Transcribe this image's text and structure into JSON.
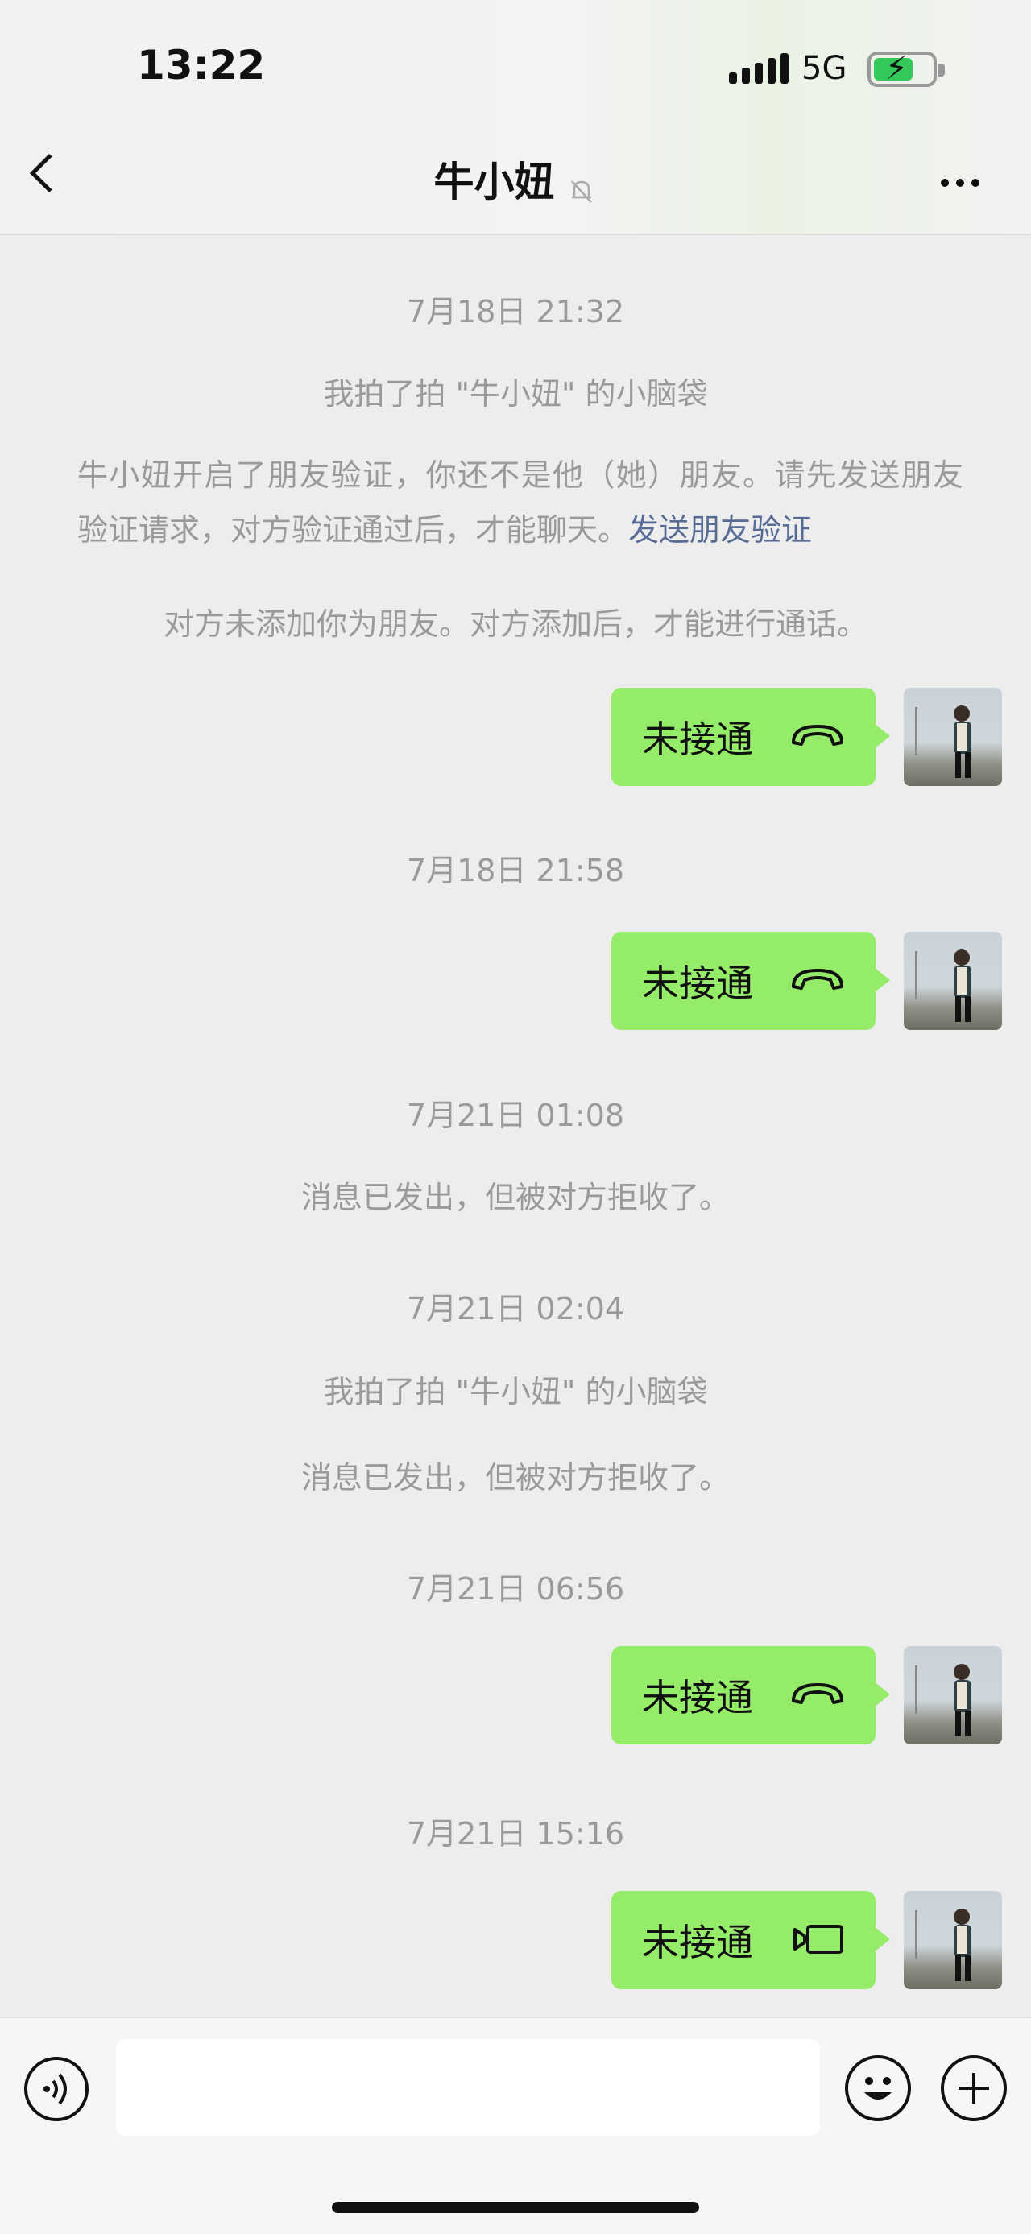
{
  "status_bar": {
    "time": "13:22",
    "network": "5G",
    "battery_level": 0.6,
    "charging": true
  },
  "nav": {
    "title": "牛小妞",
    "muted": true
  },
  "messages": [
    {
      "type": "timestamp",
      "text": "7月18日 21:32"
    },
    {
      "type": "system",
      "text": "我拍了拍 \"牛小妞\" 的小脑袋"
    },
    {
      "type": "system_link",
      "text": "牛小妞开启了朋友验证，你还不是他（她）朋友。请先发送朋友验证请求，对方验证通过后，才能聊天。",
      "link": "发送朋友验证"
    },
    {
      "type": "system",
      "text": "对方未添加你为朋友。对方添加后，才能进行通话。"
    },
    {
      "type": "call",
      "text": "未接通",
      "call_kind": "voice"
    },
    {
      "type": "timestamp",
      "text": "7月18日 21:58"
    },
    {
      "type": "call",
      "text": "未接通",
      "call_kind": "voice"
    },
    {
      "type": "timestamp",
      "text": "7月21日 01:08"
    },
    {
      "type": "system",
      "text": "消息已发出，但被对方拒收了。"
    },
    {
      "type": "timestamp",
      "text": "7月21日 02:04"
    },
    {
      "type": "system",
      "text": "我拍了拍 \"牛小妞\" 的小脑袋"
    },
    {
      "type": "system",
      "text": "消息已发出，但被对方拒收了。"
    },
    {
      "type": "timestamp",
      "text": "7月21日 06:56"
    },
    {
      "type": "call",
      "text": "未接通",
      "call_kind": "voice"
    },
    {
      "type": "timestamp",
      "text": "7月21日 15:16"
    },
    {
      "type": "call",
      "text": "未接通",
      "call_kind": "video"
    }
  ],
  "colors": {
    "bubble": "#95ec69",
    "link": "#576b95",
    "system_text": "#9a9a9a",
    "background": "#ededed"
  },
  "bottom_bar": {
    "input_value": ""
  }
}
